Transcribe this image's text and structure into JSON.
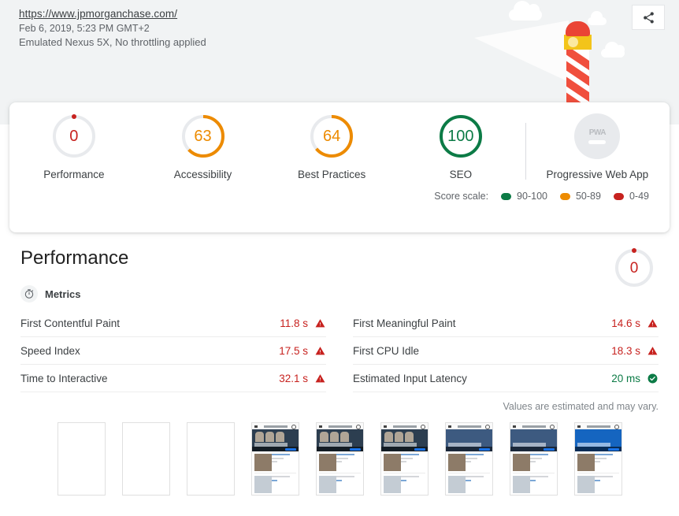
{
  "header": {
    "url": "https://www.jpmorganchase.com/",
    "timestamp": "Feb 6, 2019, 5:23 PM GMT+2",
    "environment": "Emulated Nexus 5X, No throttling applied",
    "share_icon": "share-icon",
    "illustration": "lighthouse-illustration"
  },
  "scores": {
    "categories": [
      {
        "label": "Performance",
        "value": "0",
        "score": 0,
        "color": "#c7221f",
        "state": "fail"
      },
      {
        "label": "Accessibility",
        "value": "63",
        "score": 63,
        "color": "#ed8b00",
        "state": "average"
      },
      {
        "label": "Best Practices",
        "value": "64",
        "score": 64,
        "color": "#ed8b00",
        "state": "average"
      },
      {
        "label": "SEO",
        "value": "100",
        "score": 100,
        "color": "#0c7b46",
        "state": "pass"
      },
      {
        "label": "Progressive Web App",
        "value": "PWA",
        "score": null,
        "color": "#b9bcc0",
        "state": "not-applicable"
      }
    ],
    "scale_label": "Score scale:",
    "scale": [
      {
        "range": "90-100",
        "color": "#0c7b46"
      },
      {
        "range": "50-89",
        "color": "#ed8b00"
      },
      {
        "range": "0-49",
        "color": "#c7221f"
      }
    ]
  },
  "performance": {
    "title": "Performance",
    "gauge_value": "0",
    "gauge_color": "#c7221f",
    "metrics_header": "Metrics",
    "metrics_icon": "stopwatch-icon",
    "metrics_left": [
      {
        "name": "First Contentful Paint",
        "value": "11.8 s",
        "state": "fail",
        "icon": "warning-triangle-icon"
      },
      {
        "name": "Speed Index",
        "value": "17.5 s",
        "state": "fail",
        "icon": "warning-triangle-icon"
      },
      {
        "name": "Time to Interactive",
        "value": "32.1 s",
        "state": "fail",
        "icon": "warning-triangle-icon"
      }
    ],
    "metrics_right": [
      {
        "name": "First Meaningful Paint",
        "value": "14.6 s",
        "state": "fail",
        "icon": "warning-triangle-icon"
      },
      {
        "name": "First CPU Idle",
        "value": "18.3 s",
        "state": "fail",
        "icon": "warning-triangle-icon"
      },
      {
        "name": "Estimated Input Latency",
        "value": "20 ms",
        "state": "pass",
        "icon": "check-circle-icon"
      }
    ],
    "estimated_note": "Values are estimated and may vary.",
    "filmstrip": [
      {
        "kind": "blank"
      },
      {
        "kind": "blank"
      },
      {
        "kind": "blank"
      },
      {
        "kind": "render",
        "variant": "hero-dark"
      },
      {
        "kind": "render",
        "variant": "hero-dark"
      },
      {
        "kind": "render",
        "variant": "hero-dark"
      },
      {
        "kind": "render",
        "variant": "hero-dark"
      },
      {
        "kind": "render",
        "variant": "hero-blue"
      },
      {
        "kind": "render",
        "variant": "hero-blue"
      },
      {
        "kind": "render",
        "variant": "hero-bright"
      }
    ]
  }
}
